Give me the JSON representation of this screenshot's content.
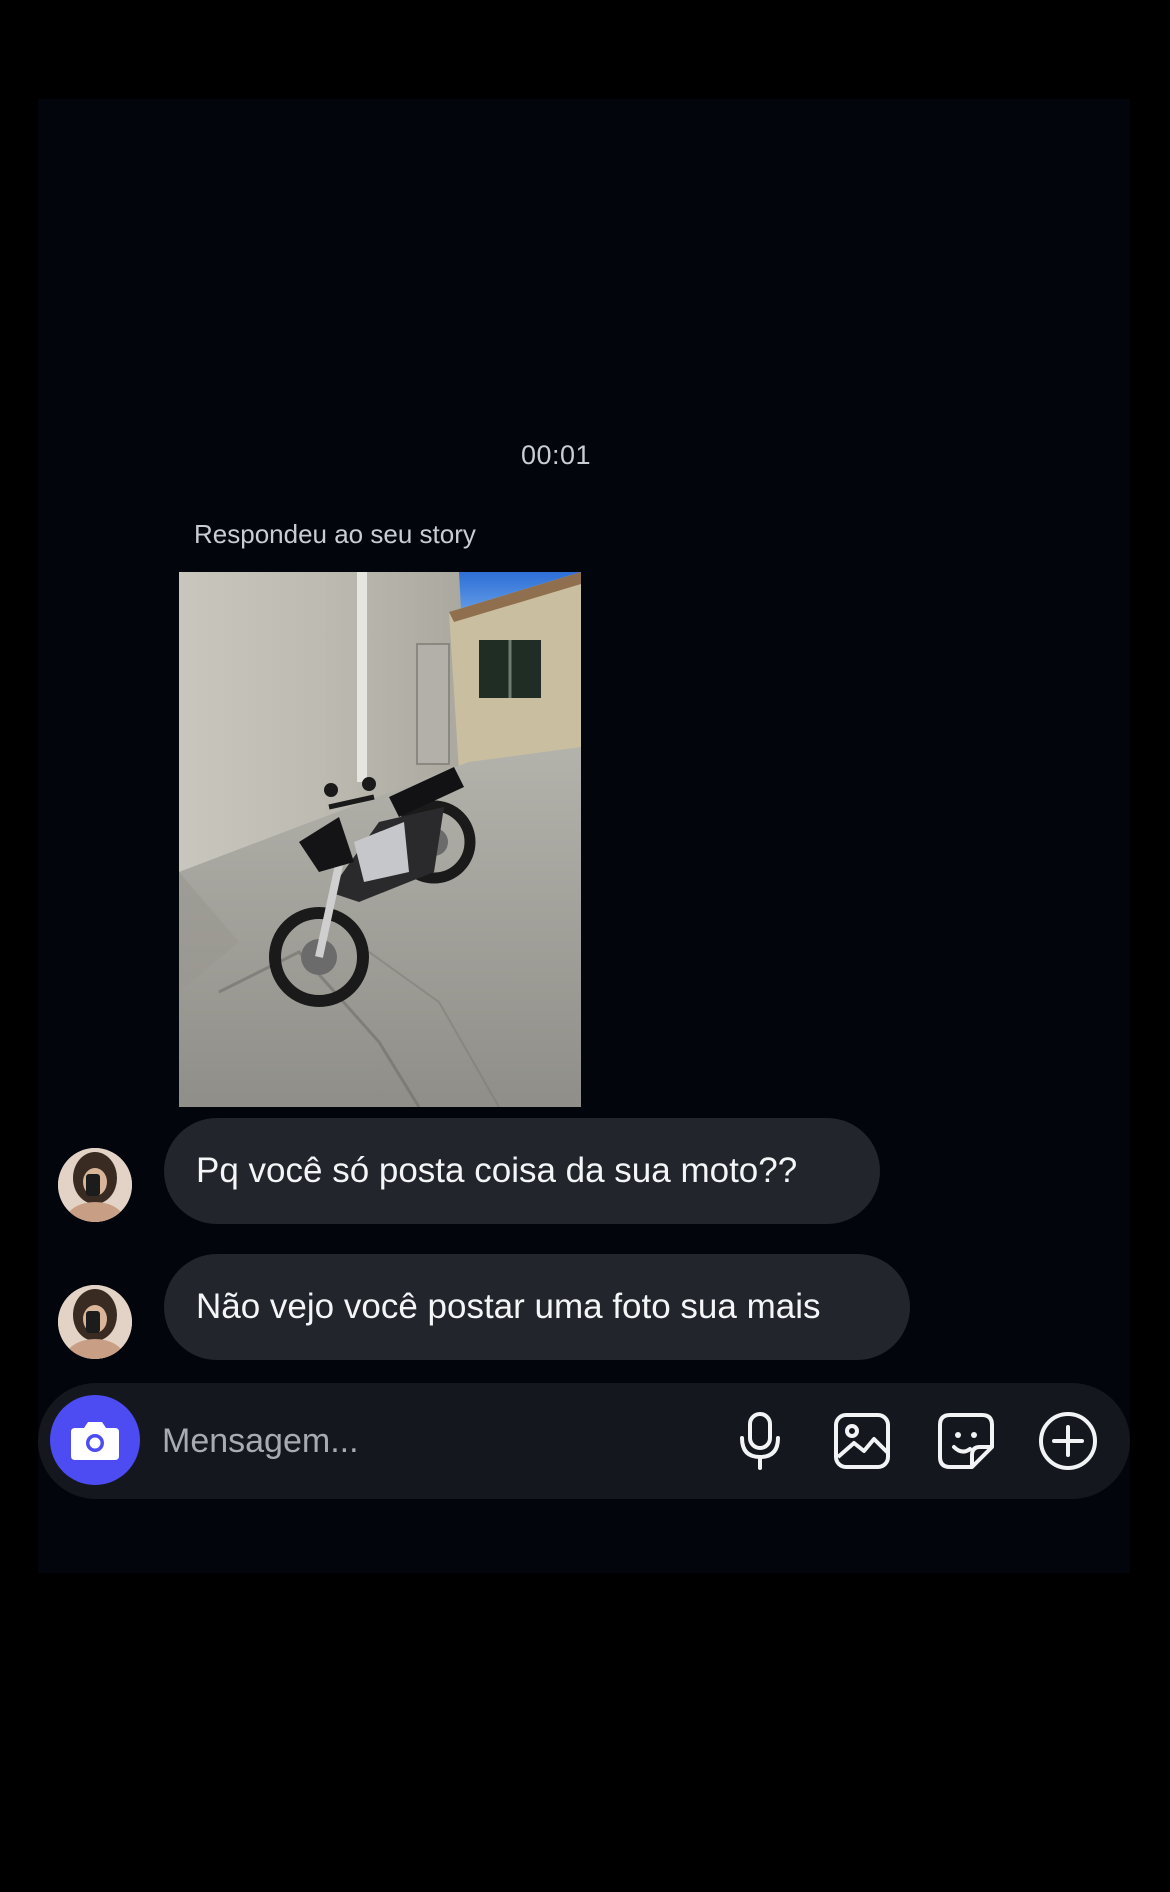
{
  "chat": {
    "timestamp": "00:01",
    "reply_label": "Respondeu ao seu story",
    "story_image": "photo of a black and silver motorcycle parked against a concrete wall",
    "messages": [
      {
        "text": "Pq você só posta coisa da sua moto??"
      },
      {
        "text": "Não vejo você postar uma foto sua mais"
      }
    ]
  },
  "composer": {
    "placeholder": "Mensagem...",
    "camera_icon": "camera-icon",
    "mic_icon": "microphone-icon",
    "gallery_icon": "image-icon",
    "sticker_icon": "sticker-icon",
    "plus_icon": "plus-circle-icon"
  },
  "colors": {
    "background": "#000000",
    "panel": "#03050c",
    "bubble": "#23252c",
    "camera_button": "#4c4cf2",
    "text_primary": "#f4f5f7",
    "text_secondary": "#c9ccd2"
  }
}
